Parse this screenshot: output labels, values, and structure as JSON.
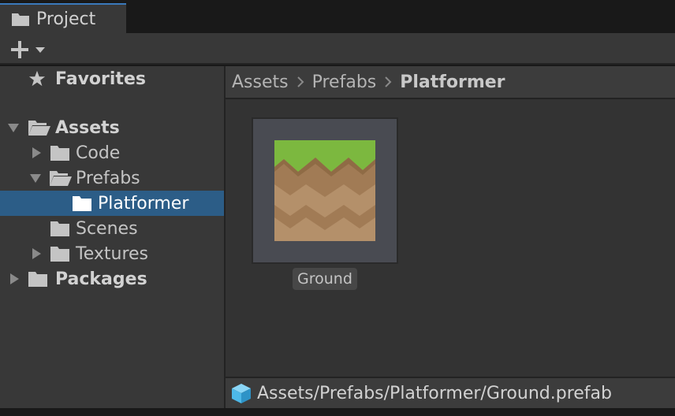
{
  "window": {
    "tab_label": "Project",
    "tab_icon": "folder-icon"
  },
  "toolbar": {
    "create_icon": "plus-icon",
    "dropdown_icon": "chevron-down-icon"
  },
  "sidebar": {
    "favorites": {
      "label": "Favorites",
      "icon": "star-icon"
    },
    "tree": [
      {
        "label": "Assets",
        "icon": "folder-open-icon",
        "expanded": true,
        "bold": true
      },
      {
        "label": "Code",
        "icon": "folder-icon",
        "expanded": false
      },
      {
        "label": "Prefabs",
        "icon": "folder-open-icon",
        "expanded": true
      },
      {
        "label": "Platformer",
        "icon": "folder-icon",
        "selected": true
      },
      {
        "label": "Scenes",
        "icon": "folder-icon"
      },
      {
        "label": "Textures",
        "icon": "folder-icon",
        "expanded": false
      },
      {
        "label": "Packages",
        "icon": "folder-icon",
        "expanded": false,
        "bold": true
      }
    ]
  },
  "breadcrumb": {
    "items": [
      "Assets",
      "Prefabs",
      "Platformer"
    ]
  },
  "assets": [
    {
      "label": "Ground",
      "type": "prefab",
      "thumbnail": "grass-dirt-tile"
    }
  ],
  "status_bar": {
    "icon": "prefab-cube-icon",
    "path": "Assets/Prefabs/Platformer/Ground.prefab"
  },
  "colors": {
    "selection": "#2c5d87",
    "tab_accent": "#3a79bb",
    "grass": "#7cb83f",
    "dirt": "#a17b55",
    "prefab_icon": "#4db8e8"
  }
}
